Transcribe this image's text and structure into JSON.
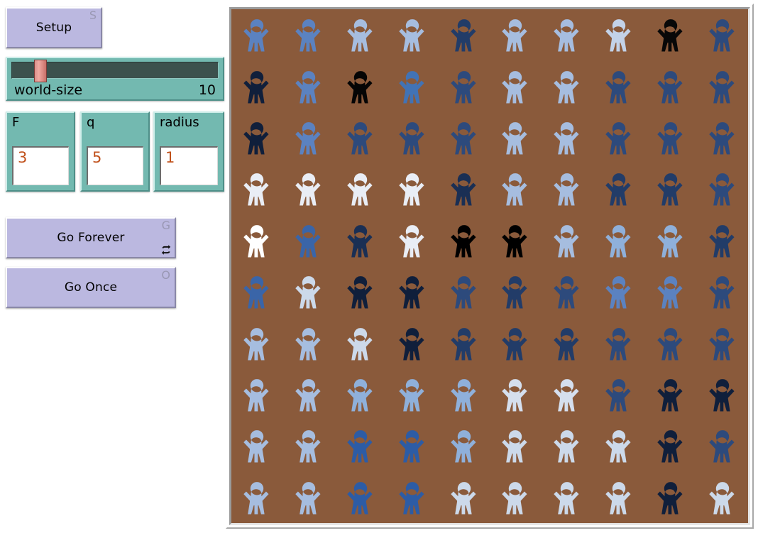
{
  "window": {
    "background": "#ffffff"
  },
  "controls": {
    "setup_button": {
      "label": "Setup",
      "hotkey": "S",
      "forever": false,
      "color": "#bbb8e0"
    },
    "go_forever_button": {
      "label": "Go Forever",
      "hotkey": "G",
      "forever": true,
      "forever_icon": "loop-icon",
      "color": "#bbb8e0"
    },
    "go_once_button": {
      "label": "Go Once",
      "hotkey": "O",
      "forever": false,
      "color": "#bbb8e0"
    },
    "world_size_slider": {
      "name": "world-size",
      "value": "10",
      "thumb_fraction": 0.115,
      "track_color": "#3c514d",
      "thumb_color": "#e09a93",
      "widget_color": "#73b9b0"
    },
    "inputs": [
      {
        "label": "F",
        "value": "3",
        "value_color": "#c0501a"
      },
      {
        "label": "q",
        "value": "5",
        "value_color": "#c0501a"
      },
      {
        "label": "radius",
        "value": "1",
        "value_color": "#c0501a"
      }
    ]
  },
  "world": {
    "background_color": "#8a5a3b",
    "rows": 10,
    "cols": 10,
    "shape": "person",
    "grid_colors": [
      [
        "#5b82c0",
        "#5b82c0",
        "#a6bddf",
        "#a6bddf",
        "#223c68",
        "#a6bddf",
        "#a6bddf",
        "#c3d2e8",
        "#080808",
        "#2d4a7c"
      ],
      [
        "#101f3b",
        "#5b82c0",
        "#050505",
        "#4273b5",
        "#2d4a7c",
        "#a6bddf",
        "#a6bddf",
        "#2d4a7c",
        "#2d4a7c",
        "#2d4a7c"
      ],
      [
        "#101f3b",
        "#5b82c0",
        "#2d4a7c",
        "#2d4a7c",
        "#2d4a7c",
        "#a6bddf",
        "#a6bddf",
        "#2d4a7c",
        "#2d4a7c",
        "#2d4a7c"
      ],
      [
        "#e9edf5",
        "#e9edf5",
        "#e9edf5",
        "#e9edf5",
        "#1a2f54",
        "#a6bddf",
        "#a6bddf",
        "#223c68",
        "#223c68",
        "#2d4a7c"
      ],
      [
        "#ffffff",
        "#3a65a8",
        "#1a2f54",
        "#e9edf5",
        "#000000",
        "#000000",
        "#a6bddf",
        "#8fb0da",
        "#8fb0da",
        "#223c68"
      ],
      [
        "#3a65a8",
        "#ccd9ea",
        "#101f3b",
        "#101f3b",
        "#2d4a7c",
        "#223c68",
        "#2d4a7c",
        "#5b82c0",
        "#5b82c0",
        "#2d4a7c"
      ],
      [
        "#a6bddf",
        "#a6bddf",
        "#ccd9ea",
        "#101f3b",
        "#223c68",
        "#223c68",
        "#223c68",
        "#2d4a7c",
        "#2d4a7c",
        "#2d4a7c"
      ],
      [
        "#a6bddf",
        "#a6bddf",
        "#8fb0da",
        "#8fb0da",
        "#8fb0da",
        "#d5dfee",
        "#d5dfee",
        "#2d4a7c",
        "#101f3b",
        "#101f3b"
      ],
      [
        "#a6bddf",
        "#a6bddf",
        "#2d5ca5",
        "#2d5ca5",
        "#8fb0da",
        "#ccd9ea",
        "#ccd9ea",
        "#ccd9ea",
        "#101f3b",
        "#2d4a7c"
      ],
      [
        "#a6bddf",
        "#a6bddf",
        "#2d5ca5",
        "#2d5ca5",
        "#ccd9ea",
        "#ccd9ea",
        "#ccd9ea",
        "#ccd9ea",
        "#101f3b",
        "#ccd9ea"
      ]
    ]
  }
}
